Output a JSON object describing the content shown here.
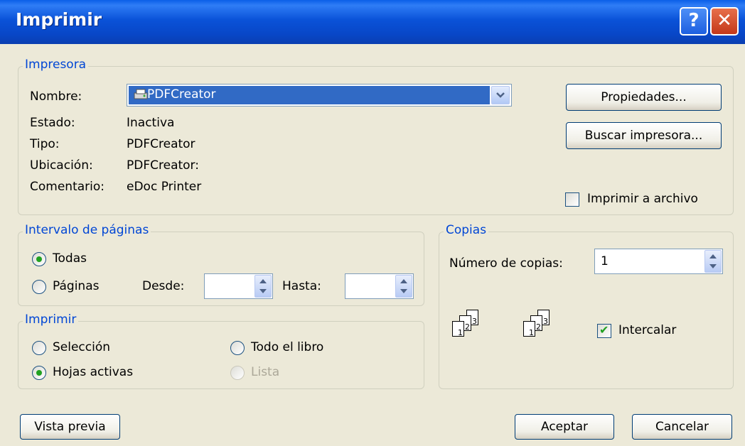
{
  "window": {
    "title": "Imprimir",
    "help": "?",
    "close": "✕"
  },
  "printer": {
    "legend": "Impresora",
    "name_label": "Nombre:",
    "selected": "PDFCreator",
    "status_label": "Estado:",
    "status_value": "Inactiva",
    "type_label": "Tipo:",
    "type_value": "PDFCreator",
    "location_label": "Ubicación:",
    "location_value": "PDFCreator:",
    "comment_label": "Comentario:",
    "comment_value": "eDoc Printer",
    "properties_btn": "Propiedades...",
    "find_btn": "Buscar impresora...",
    "print_to_file": "Imprimir a archivo"
  },
  "range": {
    "legend": "Intervalo de páginas",
    "all": "Todas",
    "pages": "Páginas",
    "from_label": "Desde:",
    "to_label": "Hasta:"
  },
  "print_what": {
    "legend": "Imprimir",
    "selection": "Selección",
    "whole_book": "Todo el libro",
    "active_sheets": "Hojas activas",
    "list": "Lista"
  },
  "copies": {
    "legend": "Copias",
    "count_label": "Número de copias:",
    "count_value": "1",
    "collate": "Intercalar",
    "collate_checked": true
  },
  "footer": {
    "preview": "Vista previa",
    "ok": "Aceptar",
    "cancel": "Cancelar"
  },
  "colors": {
    "title_blue": "#0a52d8",
    "legend_blue": "#0046d5",
    "selection": "#316ac5"
  }
}
